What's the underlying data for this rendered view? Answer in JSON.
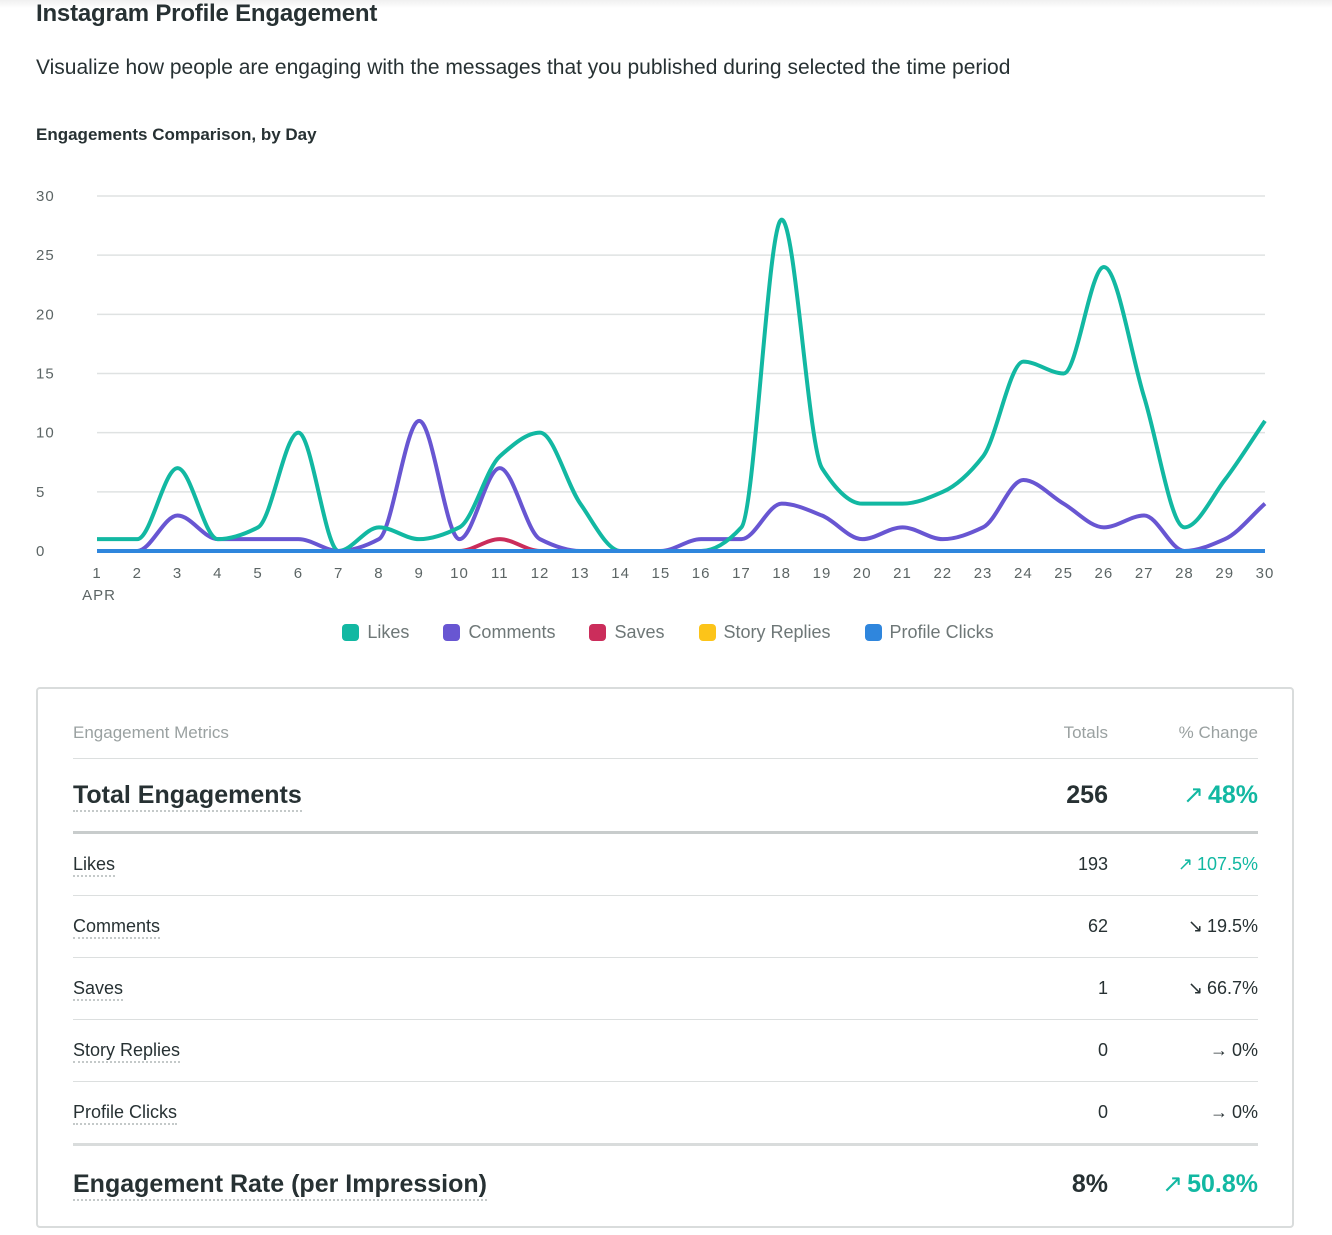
{
  "page": {
    "title": "Instagram Profile Engagement",
    "description": "Visualize how people are engaging with the messages that you published during selected the time period"
  },
  "chart_data": {
    "type": "line",
    "title": "Engagements Comparison, by Day",
    "xlabel": "APR",
    "ylabel": "",
    "x": [
      1,
      2,
      3,
      4,
      5,
      6,
      7,
      8,
      9,
      10,
      11,
      12,
      13,
      14,
      15,
      16,
      17,
      18,
      19,
      20,
      21,
      22,
      23,
      24,
      25,
      26,
      27,
      28,
      29,
      30
    ],
    "x_tick_labels": [
      "1",
      "2",
      "3",
      "4",
      "5",
      "6",
      "7",
      "8",
      "9",
      "10",
      "11",
      "12",
      "13",
      "14",
      "15",
      "16",
      "17",
      "18",
      "19",
      "20",
      "21",
      "22",
      "23",
      "24",
      "25",
      "26",
      "27",
      "28",
      "29",
      "30"
    ],
    "x_sub_label": "APR",
    "ylim": [
      0,
      30
    ],
    "y_ticks": [
      0,
      5,
      10,
      15,
      20,
      25,
      30
    ],
    "grid": true,
    "legend_position": "bottom",
    "series": [
      {
        "name": "Likes",
        "color": "#12b8a2",
        "values": [
          1,
          1,
          7,
          1,
          2,
          10,
          0,
          2,
          1,
          2,
          8,
          10,
          4,
          0,
          0,
          0,
          2,
          28,
          7,
          4,
          4,
          5,
          8,
          16,
          15,
          24,
          13,
          2,
          6,
          11
        ]
      },
      {
        "name": "Comments",
        "color": "#6856d2",
        "values": [
          0,
          0,
          3,
          1,
          1,
          1,
          0,
          1,
          11,
          1,
          7,
          1,
          0,
          0,
          0,
          1,
          1,
          4,
          3,
          1,
          2,
          1,
          2,
          6,
          4,
          2,
          3,
          0,
          1,
          4
        ]
      },
      {
        "name": "Saves",
        "color": "#cb2d5b",
        "values": [
          0,
          0,
          0,
          0,
          0,
          0,
          0,
          0,
          0,
          0,
          1,
          0,
          0,
          0,
          0,
          0,
          0,
          0,
          0,
          0,
          0,
          0,
          0,
          0,
          0,
          0,
          0,
          0,
          0,
          0
        ]
      },
      {
        "name": "Story Replies",
        "color": "#fcc419",
        "values": [
          0,
          0,
          0,
          0,
          0,
          0,
          0,
          0,
          0,
          0,
          0,
          0,
          0,
          0,
          0,
          0,
          0,
          0,
          0,
          0,
          0,
          0,
          0,
          0,
          0,
          0,
          0,
          0,
          0,
          0
        ]
      },
      {
        "name": "Profile Clicks",
        "color": "#2f86dd",
        "values": [
          0,
          0,
          0,
          0,
          0,
          0,
          0,
          0,
          0,
          0,
          0,
          0,
          0,
          0,
          0,
          0,
          0,
          0,
          0,
          0,
          0,
          0,
          0,
          0,
          0,
          0,
          0,
          0,
          0,
          0
        ]
      }
    ]
  },
  "metrics": {
    "header": {
      "label": "Engagement Metrics",
      "totals": "Totals",
      "change": "% Change"
    },
    "summary": {
      "label": "Total Engagements",
      "total": "256",
      "change_arrow": "↗",
      "change": "48%",
      "trend": "up"
    },
    "rows": [
      {
        "label": "Likes",
        "total": "193",
        "change_arrow": "↗",
        "change": "107.5%",
        "trend": "up"
      },
      {
        "label": "Comments",
        "total": "62",
        "change_arrow": "↘",
        "change": "19.5%",
        "trend": "down"
      },
      {
        "label": "Saves",
        "total": "1",
        "change_arrow": "↘",
        "change": "66.7%",
        "trend": "down"
      },
      {
        "label": "Story Replies",
        "total": "0",
        "change_arrow": "→",
        "change": "0%",
        "trend": "flat"
      },
      {
        "label": "Profile Clicks",
        "total": "0",
        "change_arrow": "→",
        "change": "0%",
        "trend": "flat"
      }
    ],
    "rate": {
      "label": "Engagement Rate (per Impression)",
      "total": "8%",
      "change_arrow": "↗",
      "change": "50.8%",
      "trend": "up"
    }
  },
  "colors": {
    "positive": "#12b8a2",
    "neutral": "#273133"
  }
}
